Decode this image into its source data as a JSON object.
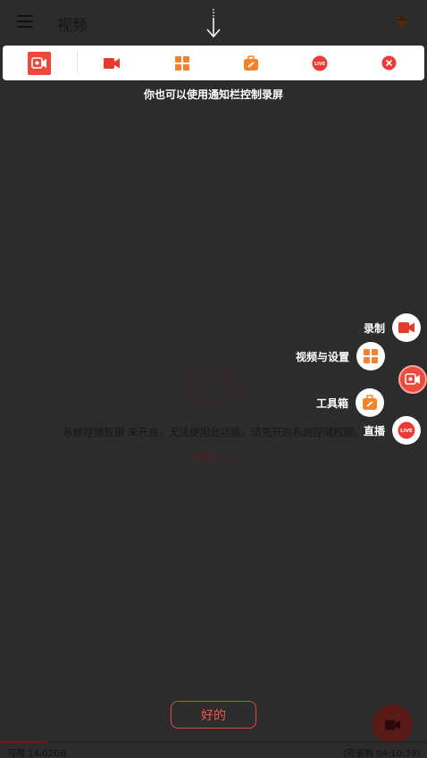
{
  "appbar": {
    "title": "视频",
    "menu_icon": "hamburger-menu-icon",
    "premium_icon": "gem-icon"
  },
  "toolbar": {
    "items": [
      {
        "name": "recorder-app-icon",
        "color": "#f0473c"
      },
      {
        "name": "record-icon",
        "color": "#e53b2f"
      },
      {
        "name": "grid-icon",
        "color": "#f5822a"
      },
      {
        "name": "toolbox-icon",
        "color": "#f5822a"
      },
      {
        "name": "live-icon",
        "color": "#ef3a34"
      },
      {
        "name": "close-icon",
        "color": "#ef3a34"
      }
    ]
  },
  "hint": "你也可以使用通知栏控制录屏",
  "empty_state": {
    "message": "系统存储权限 未开启，无法使用此功能，请先开启系统存储权限。",
    "enable_link": "启用 >>"
  },
  "floating_menu": {
    "items": [
      {
        "label": "录制",
        "icon": "record-icon"
      },
      {
        "label": "视频与设置",
        "icon": "grid-icon"
      },
      {
        "label": "工具箱",
        "icon": "toolbox-icon"
      },
      {
        "label": "直播",
        "icon": "live-icon"
      }
    ]
  },
  "ok_button": "好的",
  "status": {
    "available": "可用 14.02GB",
    "record_time": "(可录制 04:10:39)",
    "storage_used_fraction": 0.11
  },
  "colors": {
    "accent": "#f0473c",
    "orange": "#f5822a",
    "background": "#2c2c2c"
  }
}
